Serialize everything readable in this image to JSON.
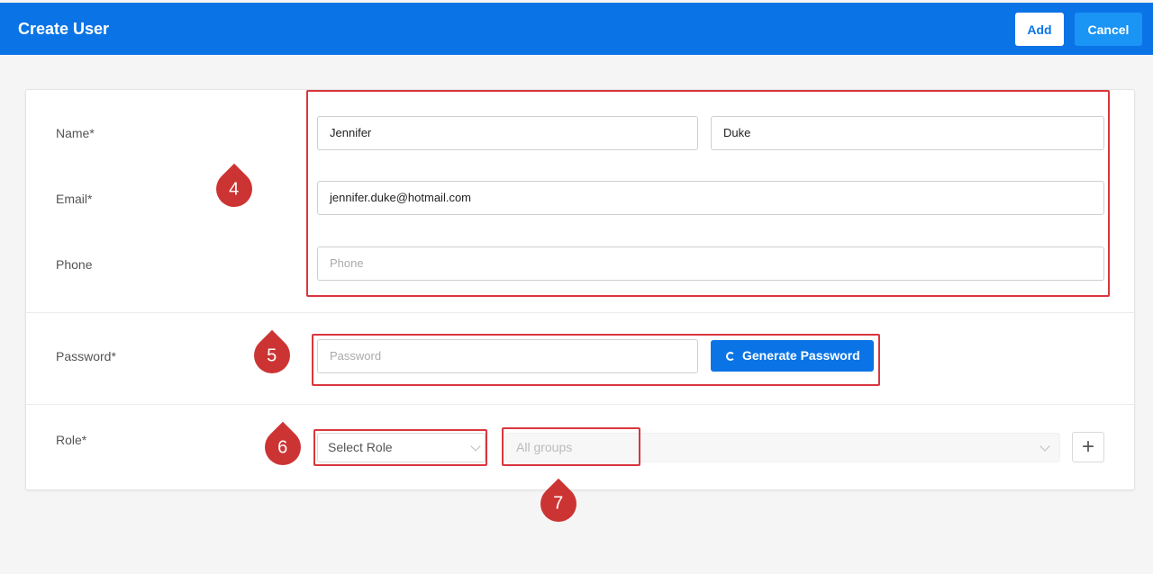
{
  "header": {
    "title": "Create User",
    "add_label": "Add",
    "cancel_label": "Cancel"
  },
  "form": {
    "name_label": "Name*",
    "first_name": "Jennifer",
    "last_name": "Duke",
    "email_label": "Email*",
    "email": "jennifer.duke@hotmail.com",
    "phone_label": "Phone",
    "phone_placeholder": "Phone",
    "password_label": "Password*",
    "password_placeholder": "Password",
    "generate_label": "Generate Password",
    "role_label": "Role*",
    "role_select": "Select Role",
    "groups_placeholder": "All groups",
    "add_group_symbol": "+"
  },
  "callouts": [
    "4",
    "5",
    "6",
    "7"
  ],
  "colors": {
    "header_bg": "#0a74e6",
    "accent": "#0a74e6",
    "highlight": "#d9363e",
    "callout": "#cc3434"
  }
}
